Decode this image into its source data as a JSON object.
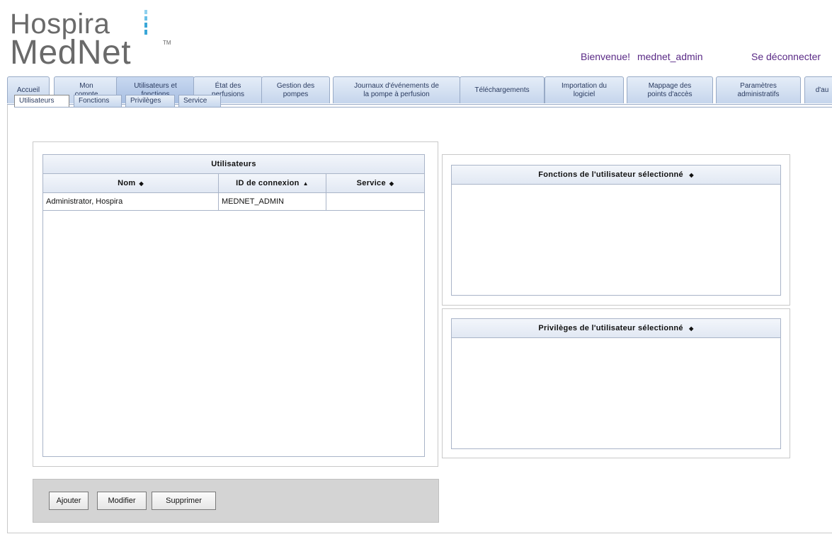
{
  "header": {
    "logo_line1": "Hospira",
    "logo_line2": "MedNet",
    "logo_tm": "TM",
    "welcome": "Bienvenue!",
    "username": "mednet_admin",
    "logout": "Se déconnecter"
  },
  "main_tabs": [
    {
      "label": "Accueil"
    },
    {
      "label": "Mon\ncompte"
    },
    {
      "label": "Utilisateurs et\nfonctions",
      "active": true
    },
    {
      "label": "État des\nperfusions"
    },
    {
      "label": "Gestion des\npompes"
    },
    {
      "label": "Journaux d'événements de\nla pompe à perfusion"
    },
    {
      "label": "Téléchargements"
    },
    {
      "label": "Importation du\nlogiciel"
    },
    {
      "label": "Mappage des\npoints d'accès"
    },
    {
      "label": "Paramètres\nadministratifs"
    },
    {
      "label": "d'au"
    }
  ],
  "sub_tabs": [
    {
      "label": "Utilisateurs",
      "active": true
    },
    {
      "label": "Fonctions"
    },
    {
      "label": "Privilèges"
    },
    {
      "label": "Service"
    }
  ],
  "users_grid": {
    "title": "Utilisateurs",
    "columns": [
      {
        "label": "Nom",
        "sort": "◆"
      },
      {
        "label": "ID de connexion",
        "sort": "▲"
      },
      {
        "label": "Service",
        "sort": "◆"
      }
    ],
    "rows": [
      [
        "Administrator, Hospira",
        "MEDNET_ADMIN",
        ""
      ]
    ]
  },
  "functions_grid": {
    "title": "Fonctions de l'utilisateur sélectionné",
    "sort": "◆"
  },
  "privileges_grid": {
    "title": "Privilèges de l'utilisateur sélectionné",
    "sort": "◆"
  },
  "actions": {
    "add": "Ajouter",
    "edit": "Modifier",
    "delete": "Supprimer"
  },
  "colors": {
    "tab_gradient_top": "#e5edf8",
    "tab_gradient_bottom": "#c5d5ec",
    "link_purple": "#5a2a86",
    "logo_blue": "#3aa7d8"
  }
}
